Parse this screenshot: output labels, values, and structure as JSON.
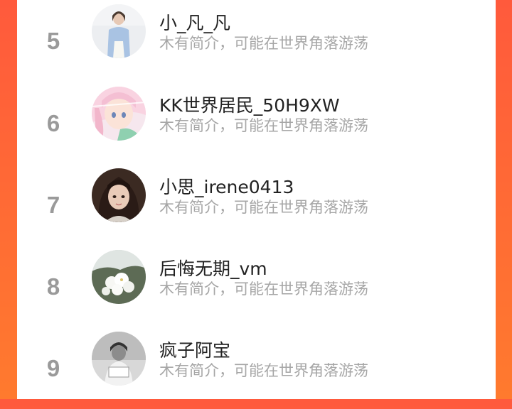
{
  "ranking": {
    "items": [
      {
        "rank": "5",
        "name": "小_凡_凡",
        "bio": "木有简介，可能在世界角落游荡",
        "avatar": "woman-in-blue-shirt-photo"
      },
      {
        "rank": "6",
        "name": "KK世界居民_50H9XW",
        "bio": "木有简介，可能在世界角落游荡",
        "avatar": "anime-girl-illustration"
      },
      {
        "rank": "7",
        "name": "小思_irene0413",
        "bio": "木有简介，可能在世界角落游荡",
        "avatar": "girl-selfie-photo"
      },
      {
        "rank": "8",
        "name": "后悔无期_vm",
        "bio": "木有简介，可能在世界角落游荡",
        "avatar": "white-flowers-photo"
      },
      {
        "rank": "9",
        "name": "疯子阿宝",
        "bio": "木有简介，可能在世界角落游荡",
        "avatar": "grayscale-person-photo"
      }
    ]
  }
}
